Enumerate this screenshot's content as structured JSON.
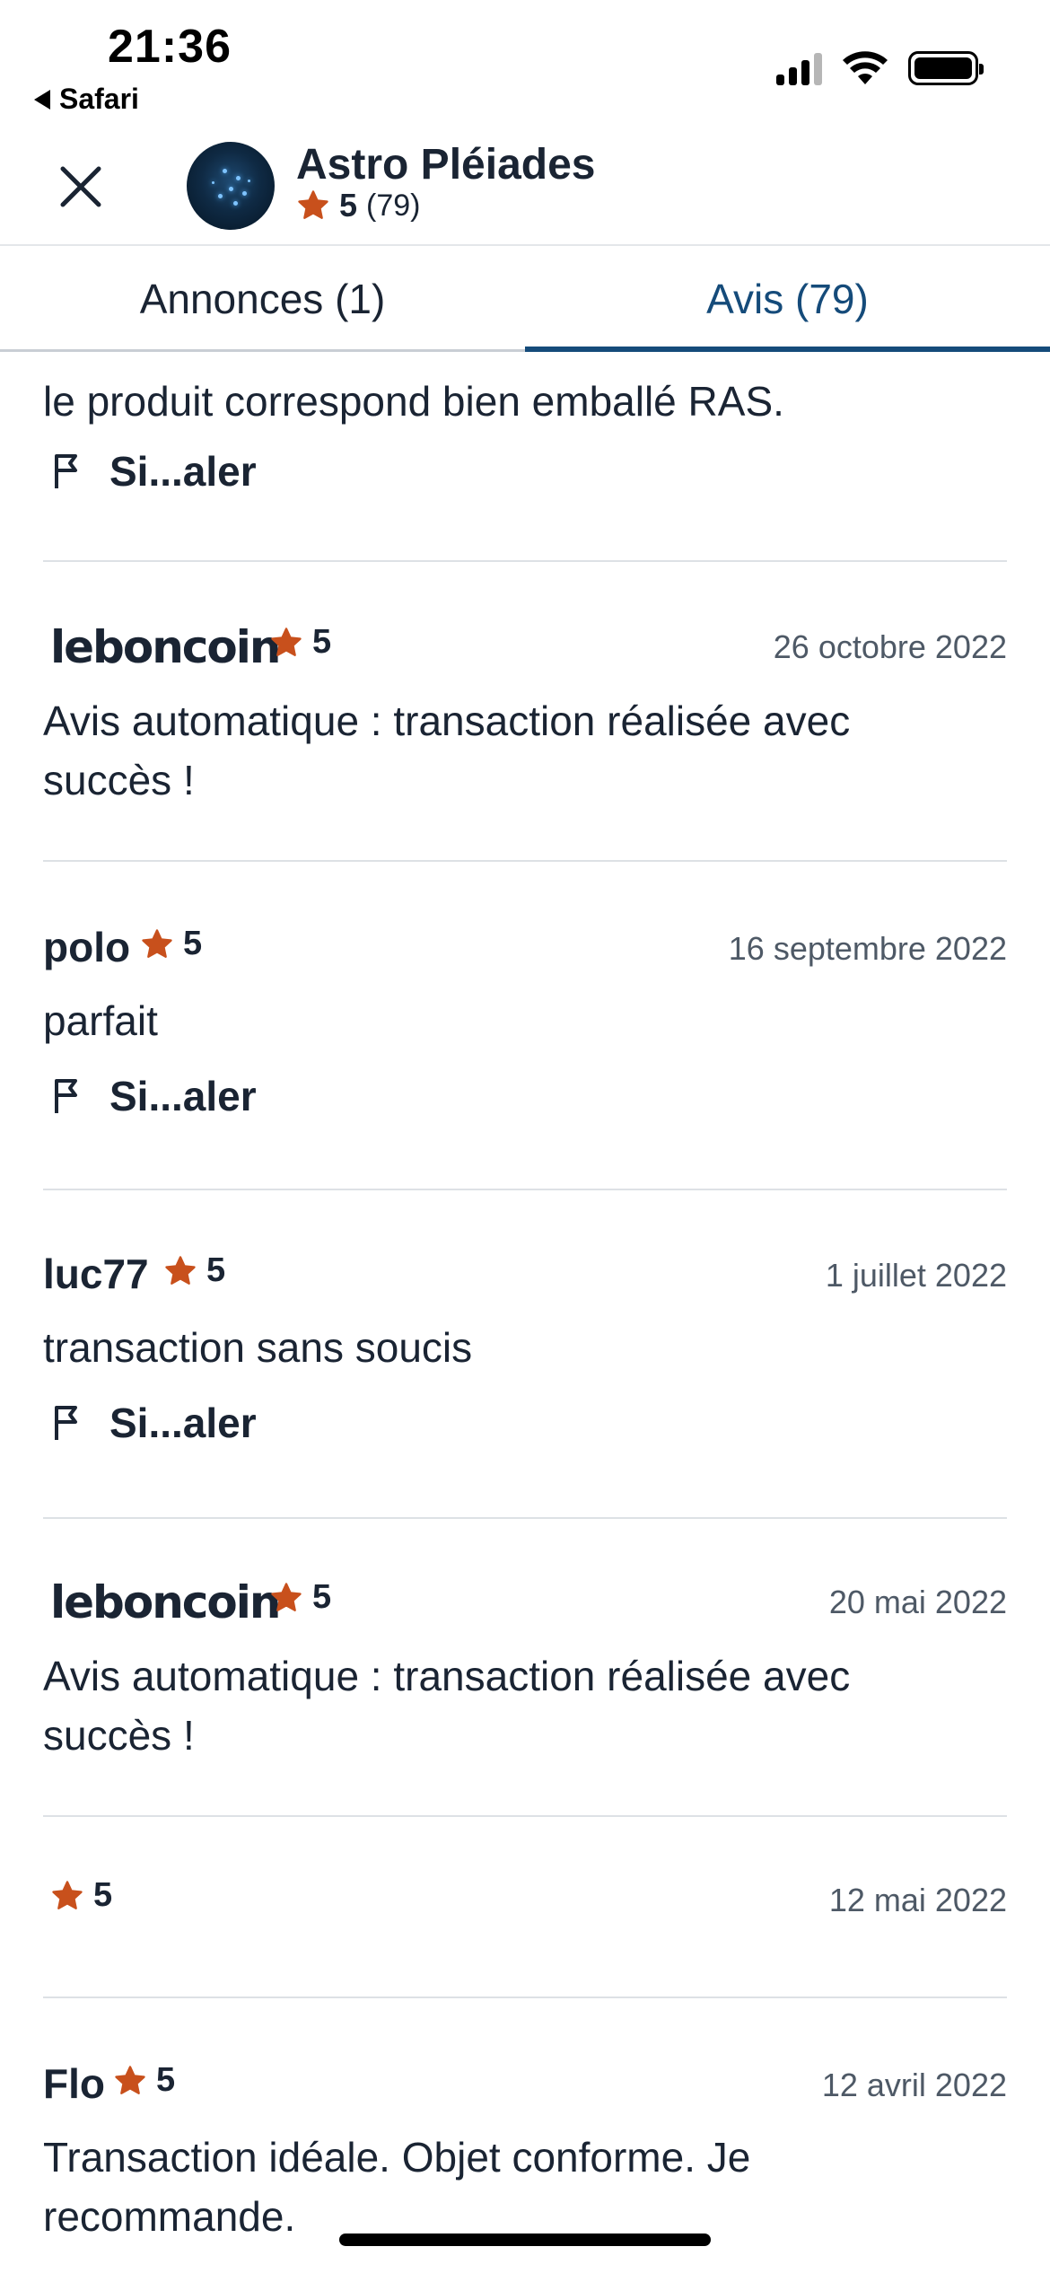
{
  "status_bar": {
    "time": "21:36",
    "back_app": "Safari"
  },
  "header": {
    "shop_name": "Astro Pléiades",
    "rating": "5",
    "rating_count": "(79)"
  },
  "tabs": [
    {
      "label": "Annonces (1)",
      "active": false
    },
    {
      "label": "Avis (79)",
      "active": true
    }
  ],
  "report_label": "Si...aler",
  "reviews": [
    {
      "text": "le produit correspond bien emballé RAS.",
      "report": true
    },
    {
      "author": "leboncoin",
      "is_logo": true,
      "rating": "5",
      "date": "26 octobre 2022",
      "text": "Avis automatique : transaction réalisée avec succès !"
    },
    {
      "author": "polo",
      "rating": "5",
      "date": "16 septembre 2022",
      "text": "parfait",
      "report": true
    },
    {
      "author": "luc77",
      "rating": "5",
      "date": "1 juillet 2022",
      "text": "transaction sans soucis",
      "report": true
    },
    {
      "author": "leboncoin",
      "is_logo": true,
      "rating": "5",
      "date": "20 mai 2022",
      "text": "Avis automatique : transaction réalisée avec succès !"
    },
    {
      "author": "",
      "rating": "5",
      "date": "12 mai 2022"
    },
    {
      "author": "Flo",
      "rating": "5",
      "date": "12 avril 2022",
      "text": "Transaction idéale. Objet conforme. Je recommande."
    }
  ],
  "colors": {
    "star": "#c8501c",
    "text": "#1a2433",
    "accent": "#154b7a",
    "date": "#4e5966"
  }
}
